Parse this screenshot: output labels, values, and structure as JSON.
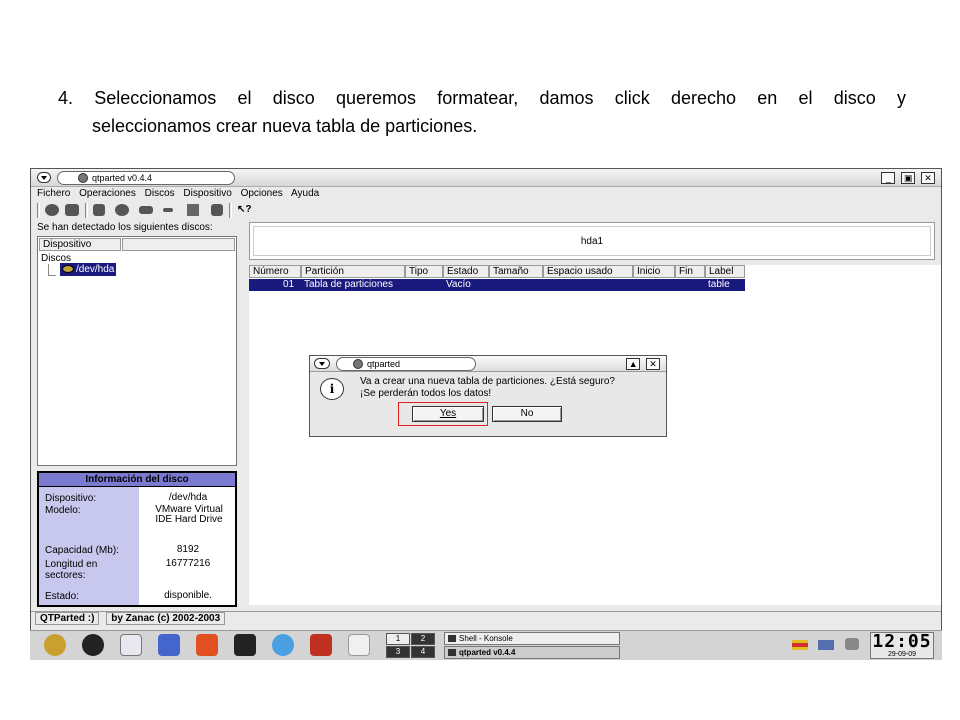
{
  "caption": {
    "line1": "4. Seleccionamos el disco queremos formatear, damos click derecho en el disco y",
    "line2": "seleccionamos crear nueva tabla de particiones."
  },
  "window": {
    "title": "qtparted v0.4.4",
    "menu": [
      "Fichero",
      "Operaciones",
      "Discos",
      "Dispositivo",
      "Opciones",
      "Ayuda"
    ]
  },
  "left_panel": {
    "detected_label": "Se han detectado los siguientes discos:",
    "tree_header": "Dispositivo",
    "tree_root": "Discos",
    "tree_node": "/dev/hda"
  },
  "disk_info": {
    "title": "Información del disco",
    "rows": [
      {
        "key": "Dispositivo:",
        "value": "/dev/hda"
      },
      {
        "key": "Modelo:",
        "value": "VMware Virtual IDE Hard Drive"
      },
      {
        "key": "Capacidad (Mb):",
        "value": "8192"
      },
      {
        "key": "Longitud en sectores:",
        "value": "16777216"
      },
      {
        "key": "Estado:",
        "value": "disponible."
      }
    ]
  },
  "disk_map": {
    "label": "hda1"
  },
  "partition_table": {
    "columns": [
      "Número",
      "Partición",
      "Tipo",
      "Estado",
      "Tamaño",
      "Espacio usado",
      "Inicio",
      "Fin",
      "Label"
    ],
    "row": {
      "number": "01",
      "partition": "Tabla de particiones",
      "state": "Vacío",
      "label": "table"
    }
  },
  "dialog": {
    "title": "qtparted",
    "message_line1": "Va a crear una nueva tabla de particiones. ¿Está seguro?",
    "message_line2": "¡Se perderán todos los datos!",
    "yes_label": "Yes",
    "no_label": "No"
  },
  "status_bar": {
    "left": "QTParted :)",
    "right": "by Zanac (c) 2002-2003"
  },
  "taskbar": {
    "pager": [
      "1",
      "2",
      "3",
      "4"
    ],
    "tasks": [
      "Shell - Konsole",
      "qtparted v0.4.4"
    ],
    "clock_time": "12:05",
    "clock_date": "29-09-09"
  }
}
